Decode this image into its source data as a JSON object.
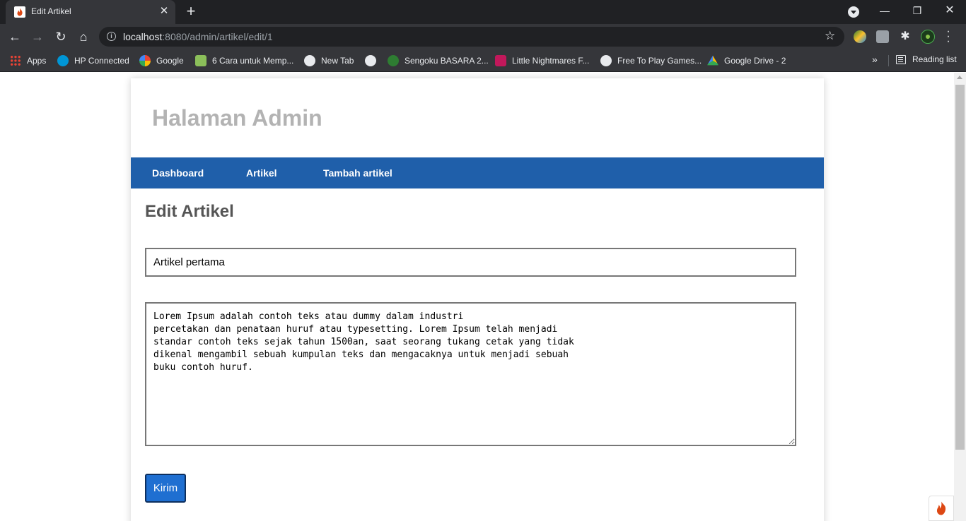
{
  "browser": {
    "tab_title": "Edit Artikel",
    "url_host": "localhost",
    "url_rest": ":8080/admin/artikel/edit/1",
    "bookmarks": [
      {
        "label": "Apps",
        "icon": "apps-grid-icon"
      },
      {
        "label": "HP Connected",
        "icon": "hp-icon"
      },
      {
        "label": "Google",
        "icon": "google-icon"
      },
      {
        "label": "6 Cara untuk Memp...",
        "icon": "wikihow-icon"
      },
      {
        "label": "New Tab",
        "icon": "globe-icon"
      },
      {
        "label": "",
        "icon": "globe-icon"
      },
      {
        "label": "Sengoku BASARA 2...",
        "icon": "game-icon"
      },
      {
        "label": "Little Nightmares F...",
        "icon": "folder-icon"
      },
      {
        "label": "Free To Play Games...",
        "icon": "steam-icon"
      },
      {
        "label": "Google Drive - 2",
        "icon": "google-drive-icon"
      }
    ],
    "bookmarks_overflow": "»",
    "reading_list": "Reading list"
  },
  "site": {
    "title": "Halaman Admin",
    "nav": [
      "Dashboard",
      "Artikel",
      "Tambah artikel"
    ]
  },
  "form": {
    "heading": "Edit Artikel",
    "title_value": "Artikel pertama",
    "body_value": "Lorem Ipsum adalah contoh teks atau dummy dalam industri\npercetakan dan penataan huruf atau typesetting. Lorem Ipsum telah menjadi\nstandar contoh teks sejak tahun 1500an, saat seorang tukang cetak yang tidak\ndikenal mengambil sebuah kumpulan teks dan mengacaknya untuk menjadi sebuah\nbuku contoh huruf.",
    "submit_label": "Kirim"
  },
  "colors": {
    "navbar": "#1f5faa",
    "submit": "#1f6fd1",
    "site_title": "#b3b3b3"
  }
}
